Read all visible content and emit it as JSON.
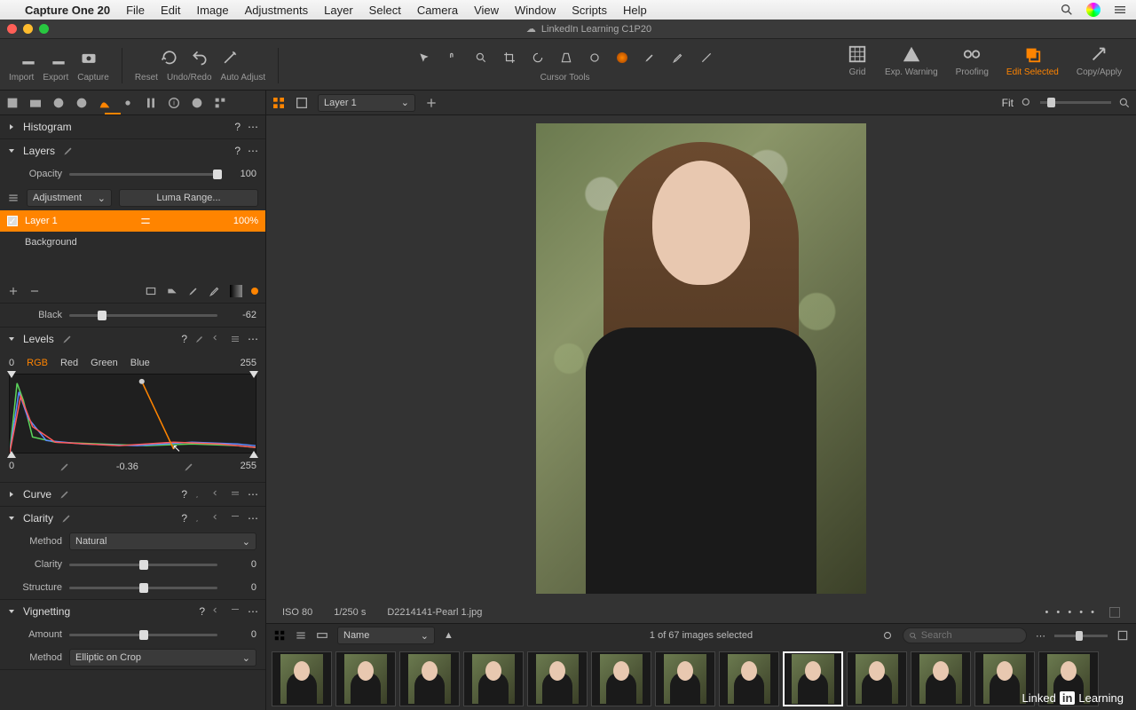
{
  "menubar": {
    "app": "Capture One 20",
    "items": [
      "File",
      "Edit",
      "Image",
      "Adjustments",
      "Layer",
      "Select",
      "Camera",
      "View",
      "Window",
      "Scripts",
      "Help"
    ]
  },
  "window_title": "LinkedIn Learning C1P20",
  "toolbar": {
    "left": [
      {
        "label": "Import",
        "icon": "import"
      },
      {
        "label": "Export",
        "icon": "export"
      },
      {
        "label": "Capture",
        "icon": "camera"
      }
    ],
    "mid": [
      {
        "label": "Reset",
        "icon": "reset"
      },
      {
        "label": "Undo/Redo",
        "icon": "undo"
      },
      {
        "label": "Auto Adjust",
        "icon": "wand"
      }
    ],
    "cursor_label": "Cursor Tools",
    "right": [
      {
        "label": "Grid",
        "icon": "grid",
        "active": false
      },
      {
        "label": "Exp. Warning",
        "icon": "warn",
        "active": false
      },
      {
        "label": "Proofing",
        "icon": "glasses",
        "active": false
      },
      {
        "label": "Edit Selected",
        "icon": "stack",
        "active": true
      },
      {
        "label": "Copy/Apply",
        "icon": "arrow",
        "active": false
      }
    ]
  },
  "viewer_bar": {
    "layer_label": "Layer 1",
    "zoom_label": "Fit"
  },
  "panels": {
    "histogram": "Histogram",
    "layers": {
      "title": "Layers",
      "opacity_label": "Opacity",
      "opacity": 100,
      "adjustment": "Adjustment",
      "luma": "Luma Range...",
      "items": [
        {
          "name": "Layer 1",
          "pct": "100%",
          "selected": true,
          "checked": true
        },
        {
          "name": "Background",
          "selected": false
        }
      ]
    },
    "black": {
      "label": "Black",
      "value": -62
    },
    "levels": {
      "title": "Levels",
      "channels": [
        "RGB",
        "Red",
        "Green",
        "Blue"
      ],
      "active": "RGB",
      "min": 0,
      "max": 255,
      "shadow": 0,
      "mid": -0.36,
      "highlight": 255
    },
    "curve": {
      "title": "Curve"
    },
    "clarity": {
      "title": "Clarity",
      "method_label": "Method",
      "method": "Natural",
      "clarity_label": "Clarity",
      "clarity": 0,
      "structure_label": "Structure",
      "structure": 0
    },
    "vignetting": {
      "title": "Vignetting",
      "amount_label": "Amount",
      "amount": 0,
      "method_label": "Method",
      "method": "Elliptic on Crop"
    }
  },
  "image_info": {
    "iso": "ISO 80",
    "shutter": "1/250 s",
    "filename": "D2214141-Pearl 1.jpg"
  },
  "browser": {
    "sort_label": "Name",
    "status": "1 of 67 images selected",
    "search_placeholder": "Search",
    "thumb_count": 13,
    "selected_index": 8
  },
  "linkedin": {
    "brand": "Linked",
    "in": "in",
    "learn": "Learning"
  }
}
